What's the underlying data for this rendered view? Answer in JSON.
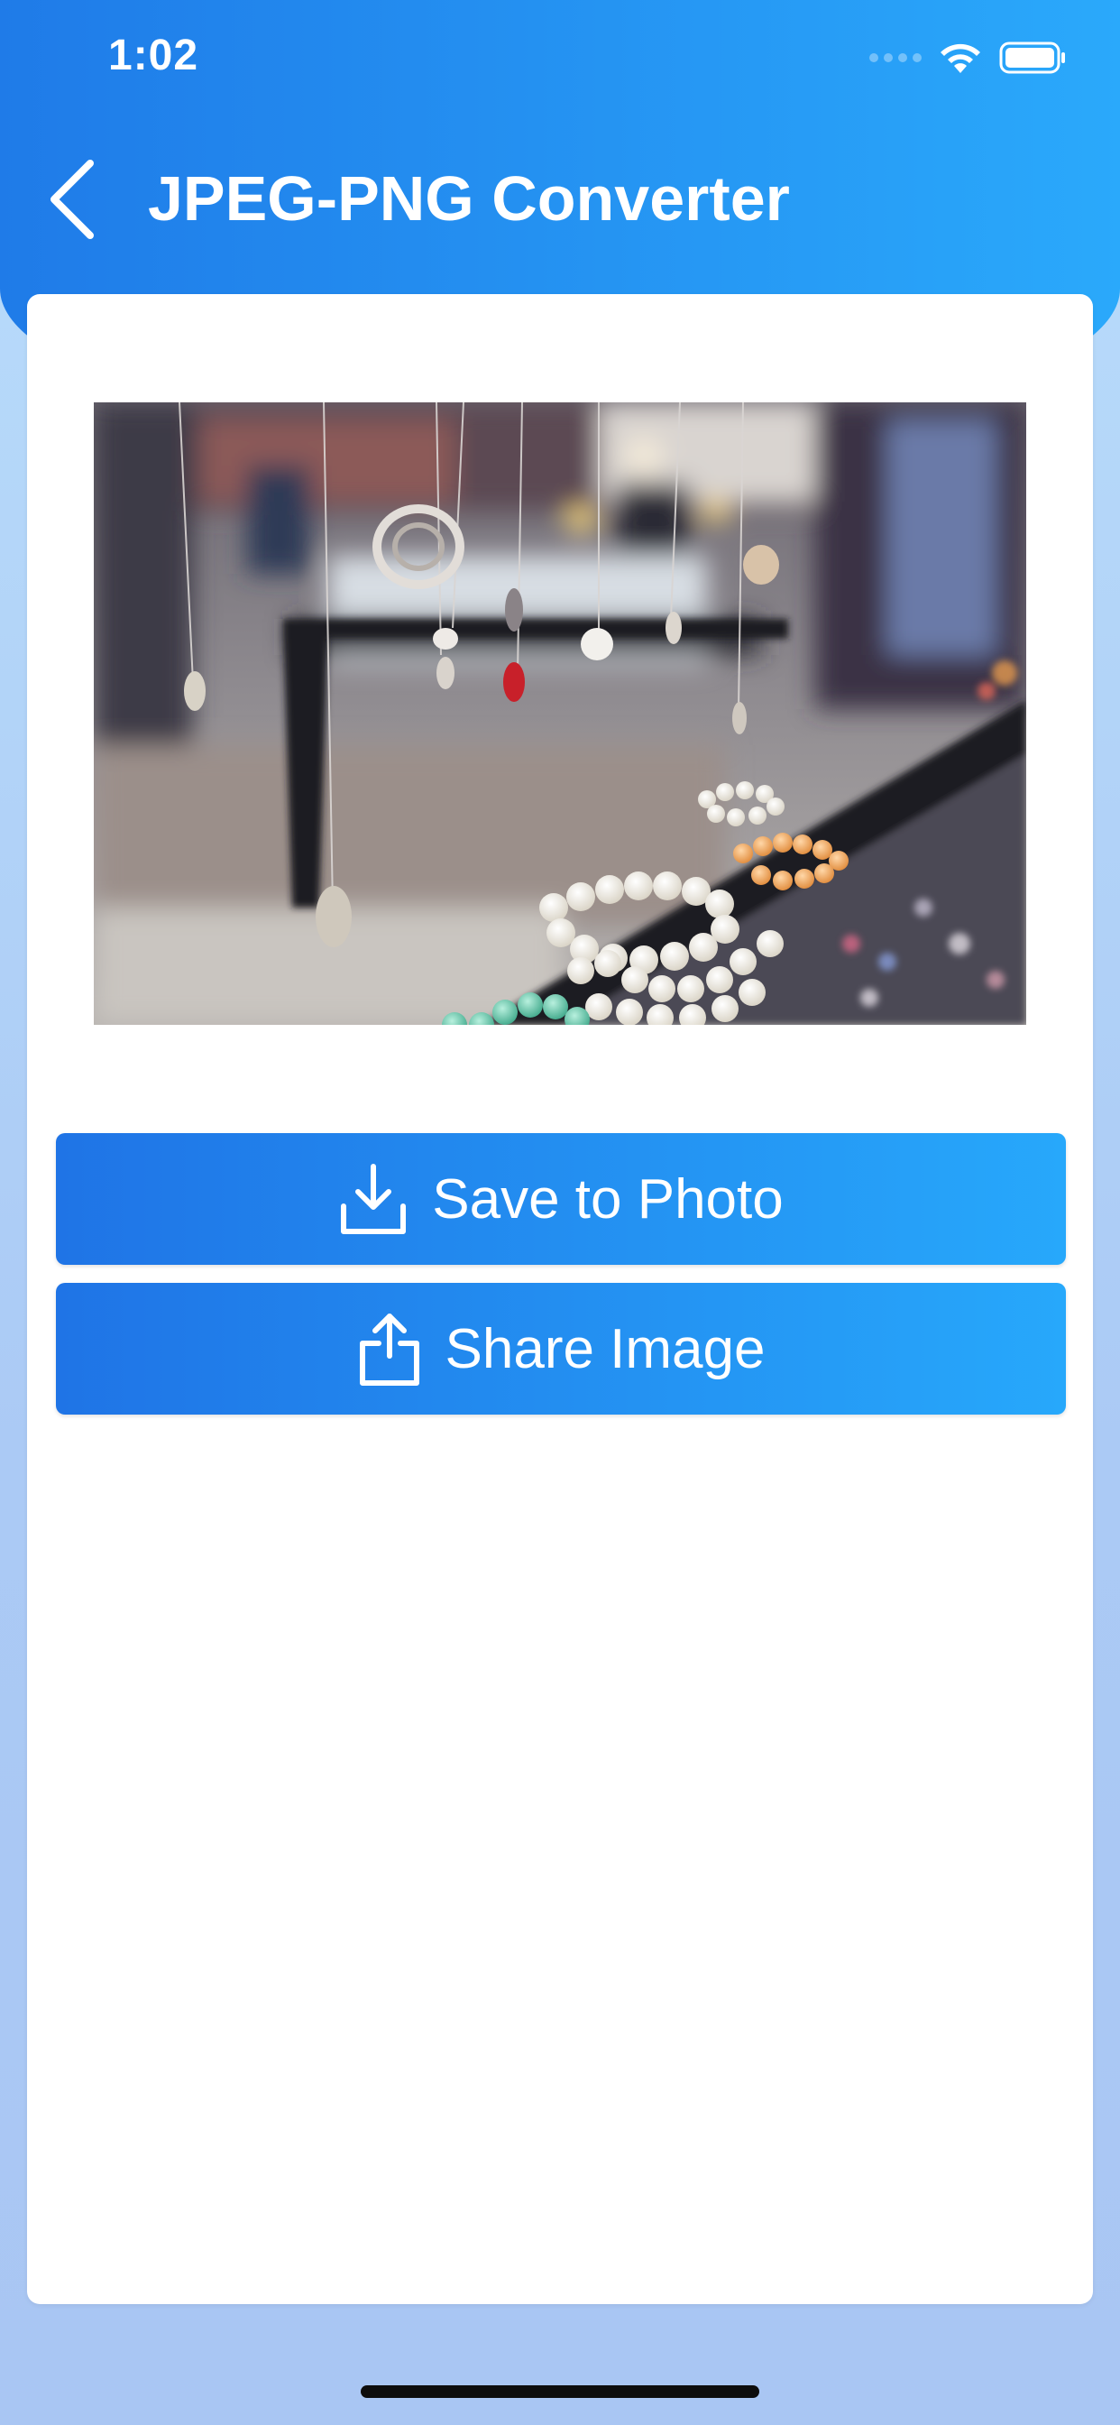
{
  "status_bar": {
    "time": "1:02"
  },
  "header": {
    "title": "JPEG-PNG Converter",
    "back_icon": "chevron-left-icon"
  },
  "preview": {
    "icon": "image-preview"
  },
  "actions": {
    "save": {
      "label": "Save to Photo",
      "icon": "download-icon"
    },
    "share": {
      "label": "Share Image",
      "icon": "share-icon"
    }
  },
  "colors": {
    "header_gradient_start": "#1f7be8",
    "header_gradient_end": "#2aa9fb",
    "button_gradient_start": "#1f74e6",
    "button_gradient_end": "#27a8fb",
    "background": "#b9ddfb",
    "card": "#ffffff"
  }
}
